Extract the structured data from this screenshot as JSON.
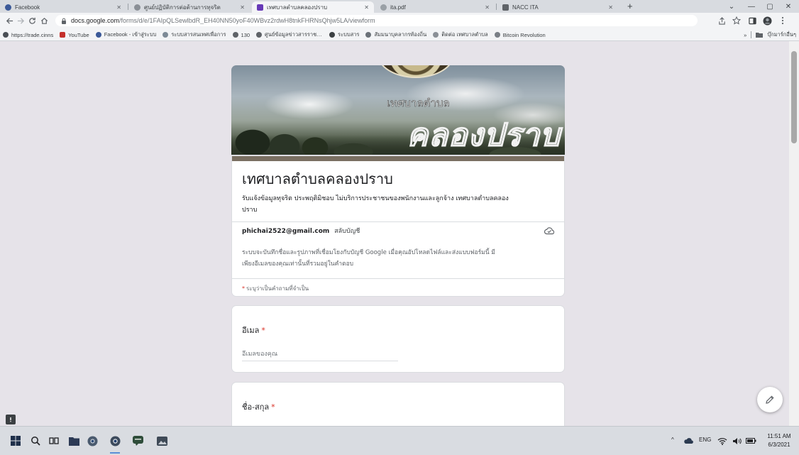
{
  "theme": {
    "page_bg": "#e6e3e9",
    "card_accent": "#7a6f62",
    "required": "#d93025"
  },
  "browser": {
    "tabs": [
      {
        "label": "Facebook",
        "icon": "facebook-icon",
        "active": false
      },
      {
        "label": "ศูนย์ปฏิบัติการต่อต้านการทุจริต",
        "icon": "globe-icon",
        "active": false
      },
      {
        "label": "เทศบาลตำบลคลองปราบ",
        "icon": "google-forms-icon",
        "active": true
      },
      {
        "label": "ita.pdf",
        "icon": "pdf-icon",
        "active": false
      },
      {
        "label": "NACC ITA",
        "icon": "nacc-icon",
        "active": false
      }
    ],
    "new_tab_label": "+",
    "address": {
      "host": "docs.google.com",
      "path": "/forms/d/e/1FAIpQLSewlbdR_EH40NN50yoF40WBvz2rdwH8tnkFHRNsQhjw5LA/viewform"
    },
    "bookmarks": [
      {
        "label": "https://trade.cinns",
        "icon": "globe-icon"
      },
      {
        "label": "YouTube",
        "icon": "youtube-icon"
      },
      {
        "label": "Facebook - เข้าสู่ระบบ",
        "icon": "facebook-icon"
      },
      {
        "label": "ระบบสารสนเทศเพื่อการ",
        "icon": "globe-icon"
      },
      {
        "label": "130",
        "icon": "globe-icon"
      },
      {
        "label": "ศูนย์ข้อมูลข่าวสารราชการ",
        "icon": "globe-icon"
      },
      {
        "label": "ระบบสาร",
        "icon": "globe-icon"
      },
      {
        "label": "สัมมนาบุคลากรท้องถิ่น",
        "icon": "globe-icon"
      },
      {
        "label": "ติดต่อ เทศบาลตำบล",
        "icon": "globe-icon"
      },
      {
        "label": "Bitcoin Revolution",
        "icon": "globe-icon"
      }
    ],
    "more_bookmarks_label": "»",
    "other_bookmarks_label": "บุ๊กมาร์กอื่นๆ"
  },
  "form": {
    "banner": {
      "line1": "เทศบาลตำบล",
      "line2": "คลองปราบ"
    },
    "title": "เทศบาลตำบลคลองปราบ",
    "description": "รับแจ้งข้อมูลทุจริต ประพฤติมิชอบ ไม่บริการประชาชนของพนักงานและลูกจ้าง เทศบาลตำบลคลอง\nปราบ",
    "account": {
      "email": "phichai2522@gmail.com",
      "switch_label": "สลับบัญชี"
    },
    "privacy_note": "ระบบจะบันทึกชื่อและรูปภาพที่เชื่อมโยงกับบัญชี Google เมื่อคุณอัปโหลดไฟล์และส่งแบบฟอร์มนี้ มี\nเพียงอีเมลของคุณเท่านั้นที่รวมอยู่ในคำตอบ",
    "required_note": {
      "mark": "*",
      "text": "ระบุว่าเป็นคำถามที่จำเป็น"
    },
    "questions": [
      {
        "label": "อีเมล",
        "required_mark": "*",
        "placeholder": "อีเมลของคุณ"
      },
      {
        "label": "ชื่อ-สกุล",
        "required_mark": "*"
      }
    ]
  },
  "taskbar": {
    "language": "ENG",
    "time": "11:51 AM",
    "date": "6/3/2021"
  }
}
